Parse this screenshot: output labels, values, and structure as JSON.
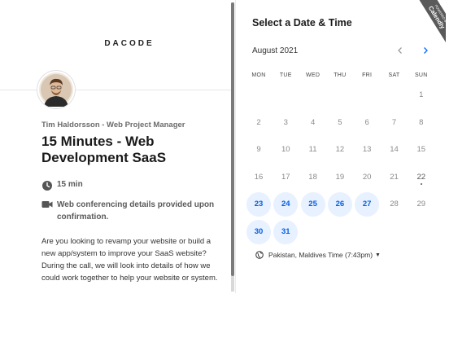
{
  "brand": {
    "logo_text": "DACODE"
  },
  "event": {
    "owner": "Tim Haldorsson - Web Project Manager",
    "title": "15 Minutes - Web Development SaaS",
    "duration": "15 min",
    "location": "Web conferencing details provided upon confirmation.",
    "description": "Are you looking to revamp your website or build a new app/system to improve your SaaS website? During the call, we will look into details of how we could work together to help your website or system."
  },
  "scheduler": {
    "heading": "Select a Date & Time",
    "month_label": "August 2021",
    "prev_icon": "chevron-left-icon",
    "next_icon": "chevron-right-icon",
    "weekdays": [
      "MON",
      "TUE",
      "WED",
      "THU",
      "FRI",
      "SAT",
      "SUN"
    ],
    "days": [
      {
        "d": "1",
        "state": "disabled"
      },
      {
        "d": "2",
        "state": "disabled"
      },
      {
        "d": "3",
        "state": "disabled"
      },
      {
        "d": "4",
        "state": "disabled"
      },
      {
        "d": "5",
        "state": "disabled"
      },
      {
        "d": "6",
        "state": "disabled"
      },
      {
        "d": "7",
        "state": "disabled"
      },
      {
        "d": "8",
        "state": "disabled"
      },
      {
        "d": "9",
        "state": "disabled"
      },
      {
        "d": "10",
        "state": "disabled"
      },
      {
        "d": "11",
        "state": "disabled"
      },
      {
        "d": "12",
        "state": "disabled"
      },
      {
        "d": "13",
        "state": "disabled"
      },
      {
        "d": "14",
        "state": "disabled"
      },
      {
        "d": "15",
        "state": "disabled"
      },
      {
        "d": "16",
        "state": "disabled"
      },
      {
        "d": "17",
        "state": "disabled"
      },
      {
        "d": "18",
        "state": "disabled"
      },
      {
        "d": "19",
        "state": "disabled"
      },
      {
        "d": "20",
        "state": "disabled"
      },
      {
        "d": "21",
        "state": "disabled"
      },
      {
        "d": "22",
        "state": "today"
      },
      {
        "d": "23",
        "state": "available"
      },
      {
        "d": "24",
        "state": "available"
      },
      {
        "d": "25",
        "state": "available"
      },
      {
        "d": "26",
        "state": "available"
      },
      {
        "d": "27",
        "state": "available"
      },
      {
        "d": "28",
        "state": "disabled"
      },
      {
        "d": "29",
        "state": "disabled"
      },
      {
        "d": "30",
        "state": "available"
      },
      {
        "d": "31",
        "state": "available"
      }
    ],
    "first_weekday_index": 6,
    "timezone": "Pakistan, Maldives Time (7:43pm)",
    "timezone_icon": "globe-icon"
  },
  "badge": {
    "line1": "POWERED BY",
    "line2": "Calendly"
  },
  "colors": {
    "accent": "#0069ff",
    "available_bg": "#e8f1ff",
    "ribbon": "#5a5a5a"
  }
}
